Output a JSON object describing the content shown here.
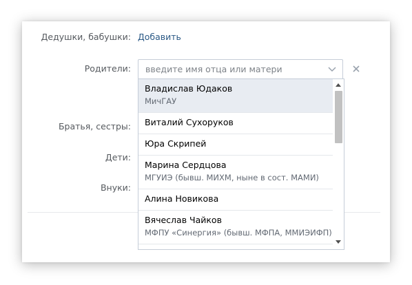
{
  "form": {
    "grandparents_label": "Дедушки, бабушки:",
    "grandparents_add": "Добавить",
    "parents_label": "Родители:",
    "parents_placeholder": "введите имя отца или матери",
    "siblings_label": "Братья, сестры:",
    "children_label": "Дети:",
    "grandchildren_label": "Внуки:"
  },
  "dropdown": {
    "items": [
      {
        "name": "Владислав Юдаков",
        "sub": "МичГАУ"
      },
      {
        "name": "Виталий Сухоруков"
      },
      {
        "name": "Юра Скрипей"
      },
      {
        "name": "Марина Сердцова",
        "sub": "МГУИЭ (бывш. МИХМ, ныне в сост. МАМИ)"
      },
      {
        "name": "Алина Новикова"
      },
      {
        "name": "Вячеслав Чайков",
        "sub": "МФПУ «Синергия» (бывш. МФПА, ММИЭИФП)"
      }
    ]
  },
  "colors": {
    "link": "#2a5885",
    "label": "#55595e",
    "highlight": "#e8ecf2",
    "border": "#c5cdd8"
  },
  "icons": {
    "expand": "chevron-down-icon",
    "clear": "close-icon",
    "scroll_up": "arrow-up-icon",
    "scroll_down": "arrow-down-icon"
  }
}
